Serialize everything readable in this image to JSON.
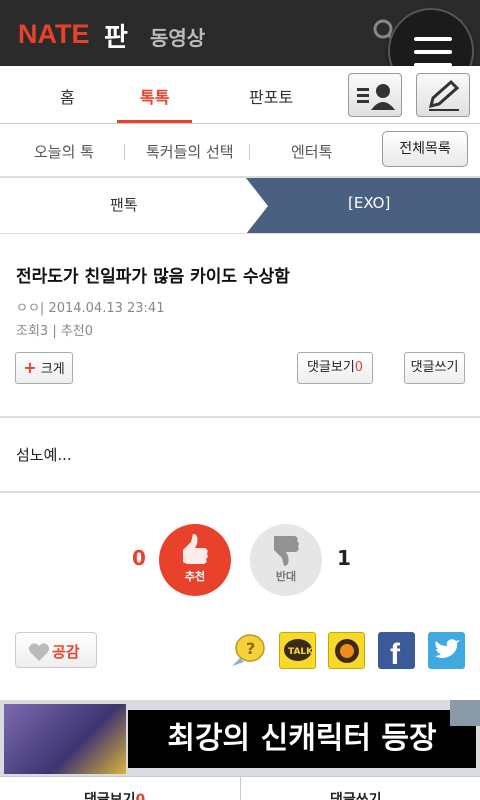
{
  "header": {
    "logo": "NATE",
    "pan": "판",
    "video": "동영상",
    "icons": [
      "search-icon",
      "grid-icon",
      "menu-icon"
    ]
  },
  "nav": {
    "tabs": [
      {
        "label": "홈"
      },
      {
        "label": "톡톡"
      },
      {
        "label": "판포토"
      }
    ],
    "active": "톡톡",
    "accent": "#e8412c"
  },
  "subnav": {
    "items": [
      {
        "label": "오늘의 톡"
      },
      {
        "label": "톡커들의 선택"
      },
      {
        "label": "엔터톡"
      }
    ],
    "all_button": "전체목록"
  },
  "breadcrumb": {
    "left": "팬톡",
    "right": "[EXO]"
  },
  "article": {
    "title": "전라도가 친일파가 많음 카이도 수상함",
    "author_date": "ㅇㅇ|  2014.04.13 23:41",
    "stats": "조회3 | 추천0",
    "enlarge_label": "크게",
    "view_comments_label": "댓글보기",
    "comment_count": "0",
    "write_comment_label": "댓글쓰기",
    "body": "섬노예..."
  },
  "vote": {
    "up_count": "0",
    "up_label": "추천",
    "down_count": "1",
    "down_label": "반대"
  },
  "social": {
    "like_label": "공감",
    "share_icons": [
      "mypeople-icon",
      "kakaotalk-icon",
      "kakaostory-icon",
      "facebook-icon",
      "twitter-icon"
    ]
  },
  "ad": {
    "text": "최강의 신캐릭터 등장"
  },
  "bottom": {
    "left": "댓글보기",
    "left_count": "0",
    "right": "댓글쓰기"
  }
}
